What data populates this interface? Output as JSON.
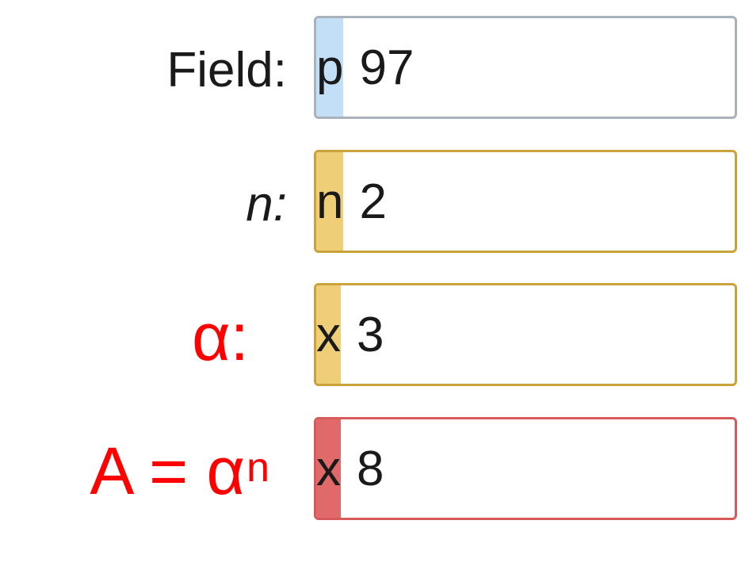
{
  "rows": [
    {
      "label": "Field:",
      "tag": "p",
      "value": "97",
      "border_color": "#a9b2bb",
      "tag_color": "#c3dff7"
    },
    {
      "label": "n:",
      "tag": "n",
      "value": "2",
      "border_color": "#c9a23c",
      "tag_color": "#efce78"
    },
    {
      "label": "α:",
      "tag": "x",
      "value": "3",
      "border_color": "#c9a23c",
      "tag_color": "#efce78"
    },
    {
      "label_base": "A = α",
      "label_sup": "n",
      "tag": "x",
      "value": "8",
      "border_color": "#d65a5a",
      "tag_color": "#e06a6a"
    }
  ],
  "annotation_color": "#ff0000"
}
